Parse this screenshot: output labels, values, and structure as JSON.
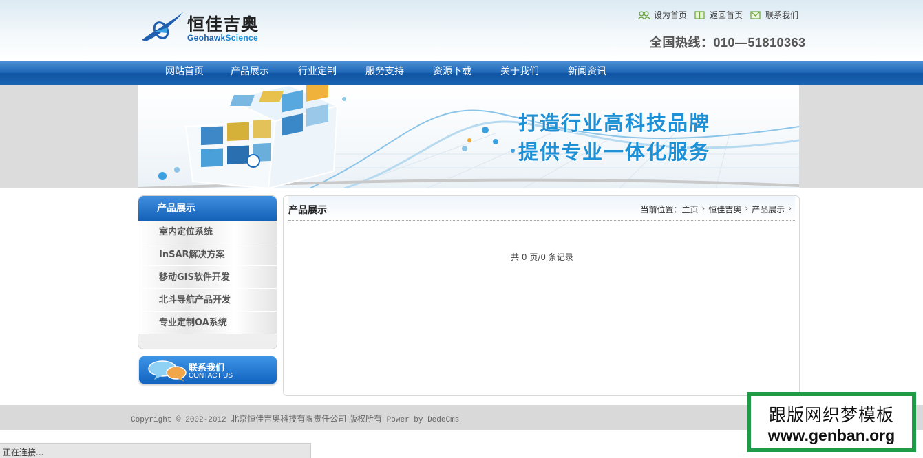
{
  "brand": {
    "name_cn": "恒佳吉奥",
    "name_en_a": "Geohawk",
    "name_en_b": "Science"
  },
  "top_links": [
    {
      "label": "设为首页",
      "icon": "people-icon"
    },
    {
      "label": "返回首页",
      "icon": "book-icon"
    },
    {
      "label": "联系我们",
      "icon": "mail-icon"
    }
  ],
  "hotline": "全国热线：010—51810363",
  "nav": [
    "网站首页",
    "产品展示",
    "行业定制",
    "服务支持",
    "资源下载",
    "关于我们",
    "新闻资讯"
  ],
  "banner": {
    "line1": "打造行业高科技品牌",
    "line2": "提供专业一体化服务"
  },
  "sidebar": {
    "title": "产品展示",
    "items": [
      "室内定位系统",
      "InSAR解决方案",
      "移动GIS软件开发",
      "北斗导航产品开发",
      "专业定制OA系统"
    ]
  },
  "contact": {
    "cn": "联系我们",
    "en": "CONTACT US"
  },
  "main": {
    "title": "产品展示",
    "breadcrumb_prefix": "当前位置：",
    "breadcrumb": [
      "主页",
      "恒佳吉奥",
      "产品展示"
    ],
    "records": "共 0 页/0 条记录"
  },
  "footer": {
    "copyright_a": "Copyright © 2002-2012 ",
    "copyright_cn": "北京恒佳吉奥科技有限责任公司 版权所有",
    "copyright_b": " Power by DedeCms"
  },
  "status": "正在连接...",
  "watermark": {
    "cn": "跟版网织梦模板",
    "en": "www.genban.org"
  },
  "colors": {
    "nav": "#1f68b8",
    "slogan": "#1e90d6",
    "accent": "#1a8fdb",
    "watermark": "#1f9a47"
  }
}
